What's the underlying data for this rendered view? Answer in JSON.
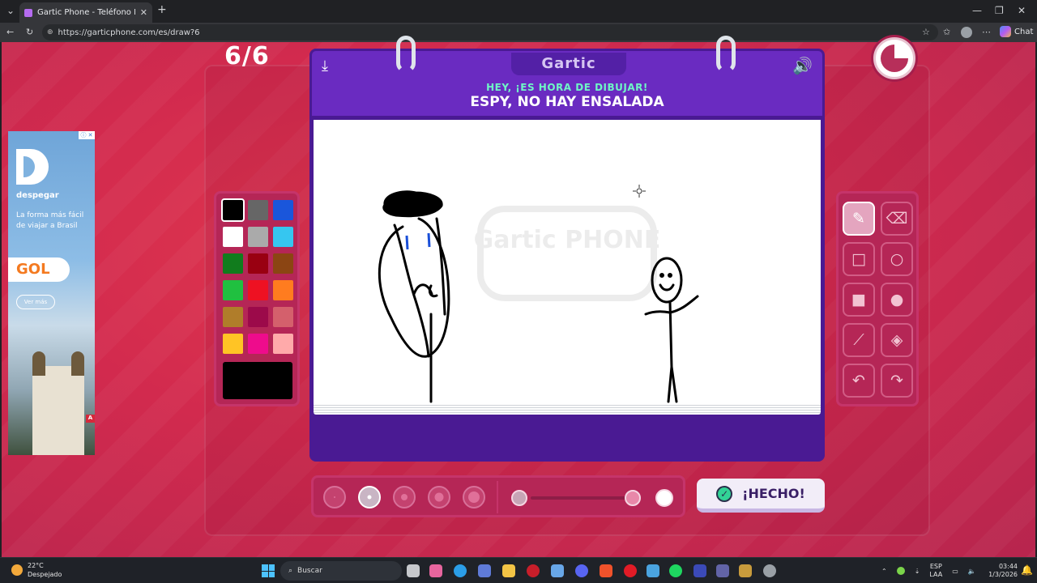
{
  "browser": {
    "tab_title": "Gartic Phone - Teléfono Descomp",
    "url": "https://garticphone.com/es/draw?6",
    "chat_label": "Chat"
  },
  "ad": {
    "brand": "despegar",
    "tagline": "La forma más fácil de viajar a Brasil",
    "partner": "GOL",
    "cta": "Ver más"
  },
  "game": {
    "round": "6/6",
    "logo": "Gartic",
    "subtitle": "HEY, ¡ES HORA DE DIBUJAR!",
    "prompt": "ESPY, NO HAY ENSALADA",
    "watermark": "Gartic PHONE",
    "done_label": "¡HECHO!",
    "timer_remaining": 0.75,
    "palette": [
      "#000000",
      "#666666",
      "#1a56db",
      "#ffffff",
      "#aaaaaa",
      "#36c6f0",
      "#117c1d",
      "#990011",
      "#8b4513",
      "#20c040",
      "#ee1122",
      "#ff7c1f",
      "#b07d2a",
      "#9c0a4a",
      "#d4606c",
      "#ffc425",
      "#ee0c8c",
      "#ffaaaa"
    ],
    "selected_color": "#000000",
    "selected_tool": "pencil",
    "selected_brush_size": 2,
    "brush_sizes": [
      1,
      2,
      3,
      4,
      5
    ],
    "opacity_level": 0.9
  },
  "taskbar": {
    "weather_temp": "22°C",
    "weather_desc": "Despejado",
    "search_placeholder": "Buscar",
    "lang_top": "ESP",
    "lang_bottom": "LAA",
    "time": "03:44",
    "date": "1/3/2026"
  }
}
